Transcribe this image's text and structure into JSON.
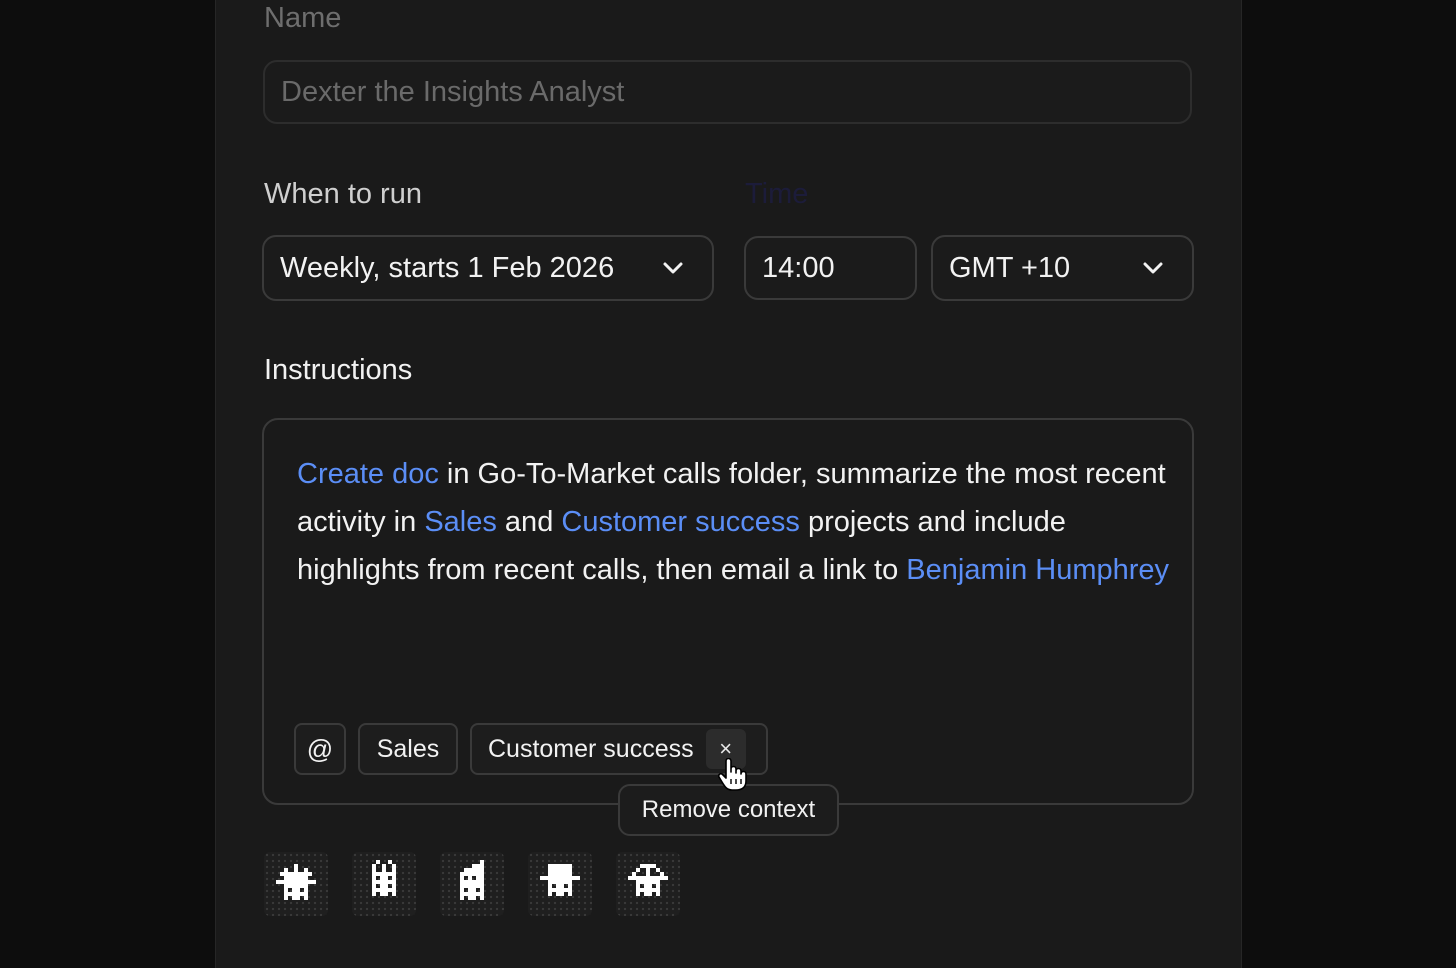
{
  "form": {
    "name_label": "Name",
    "name_value": "Dexter the Insights Analyst",
    "when_label": "When to run",
    "schedule_value": "Weekly, starts 1 Feb 2026",
    "time_label": "Time",
    "time_value": "14:00",
    "timezone_value": "GMT +10",
    "instructions_label": "Instructions"
  },
  "instructions": {
    "seg1": "Create doc",
    "seg2": " in Go-To-Market calls folder, summarize the most recent activity in ",
    "seg3": "Sales",
    "seg4": " and ",
    "seg5": "Customer success",
    "seg6": " projects and include highlights from recent calls, then email a link to ",
    "seg7": "Benjamin Humphrey"
  },
  "context": {
    "at_symbol": "@",
    "chips": [
      "Sales",
      "Customer success"
    ],
    "remove_symbol": "×",
    "tooltip": "Remove context"
  },
  "avatars": [
    "crown-robot-icon",
    "spiky-robot-icon",
    "party-hat-robot-icon",
    "fedora-robot-icon",
    "umbrella-robot-icon"
  ],
  "colors": {
    "background": "#0d0d0d",
    "panel": "#1a1a1a",
    "mention": "#5b8ef6",
    "border": "#3a3a3a"
  }
}
